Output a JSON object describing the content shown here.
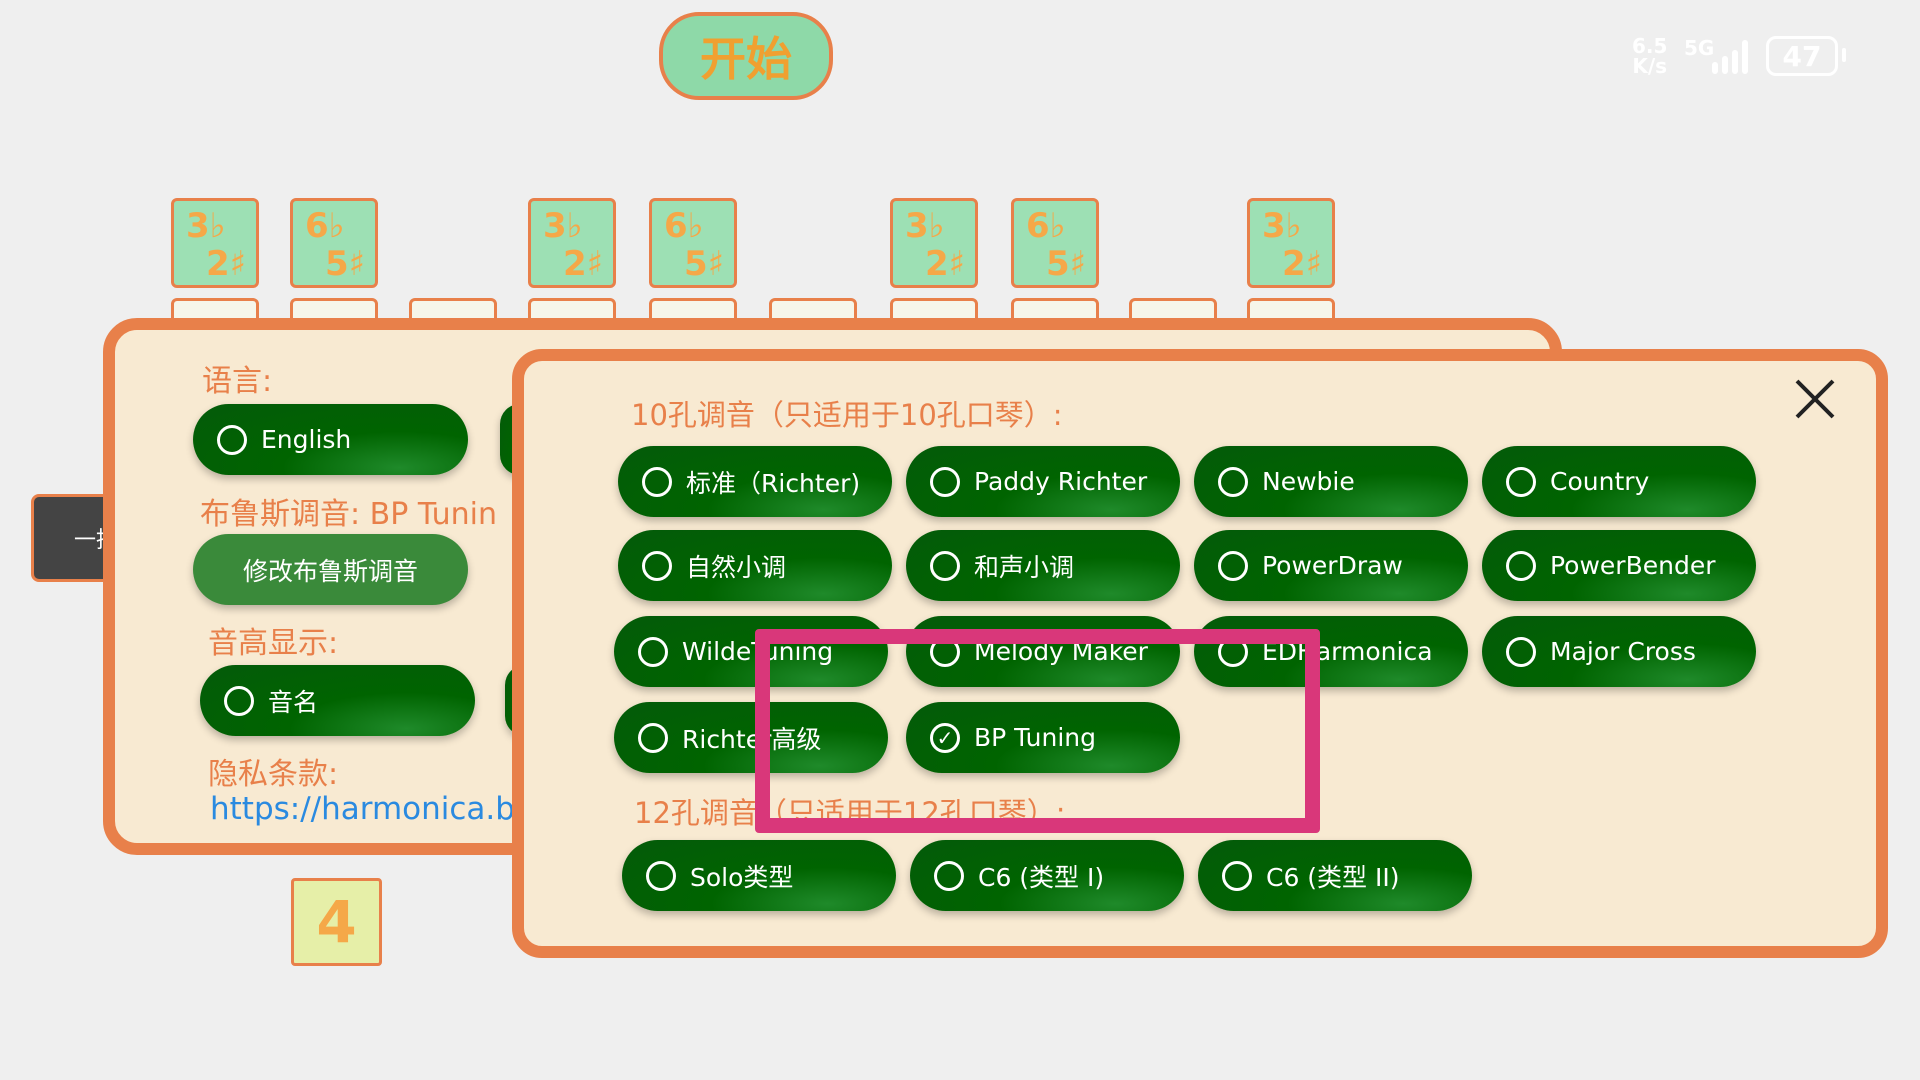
{
  "status_bar": {
    "net_speed_value": "6.5",
    "net_speed_unit": "K/s",
    "network": "5G",
    "battery": "47"
  },
  "start_button": "开始",
  "harmonica_keys": {
    "top": [
      [
        "3♭",
        "2♯"
      ],
      [
        "6♭",
        "5♯"
      ],
      [
        "3♭",
        "2♯"
      ],
      [
        "6♭",
        "5♯"
      ],
      [
        "3♭",
        "2♯"
      ],
      [
        "6♭",
        "5♯"
      ],
      [
        "3♭",
        "2♯"
      ]
    ],
    "bottom_key": "4"
  },
  "side_tab": "一指",
  "settings": {
    "language_label": "语言:",
    "language_option": "English",
    "blues_label": "布鲁斯调音: BP Tunin",
    "modify_blues_button": "修改布鲁斯调音",
    "pitch_label": "音高显示:",
    "pitch_option": "音名",
    "privacy_label": "隐私条款:",
    "privacy_link": "https://harmonica.ba"
  },
  "tuning_dialog": {
    "heading_10": "10孔调音（只适用于10孔口琴）:",
    "options_10": [
      {
        "label": "标准（Richter)",
        "selected": false
      },
      {
        "label": "Paddy Richter",
        "selected": false
      },
      {
        "label": "Newbie",
        "selected": false
      },
      {
        "label": "Country",
        "selected": false
      },
      {
        "label": "自然小调",
        "selected": false
      },
      {
        "label": "和声小调",
        "selected": false
      },
      {
        "label": "PowerDraw",
        "selected": false
      },
      {
        "label": "PowerBender",
        "selected": false
      },
      {
        "label": "WildeTuning",
        "selected": false
      },
      {
        "label": "Melody Maker",
        "selected": false
      },
      {
        "label": "EDHarmonica",
        "selected": false
      },
      {
        "label": "Major Cross",
        "selected": false
      },
      {
        "label": "Richter高级",
        "selected": false
      },
      {
        "label": "BP Tuning",
        "selected": true
      }
    ],
    "heading_12": "12孔调音（只适用于12孔口琴）:",
    "options_12": [
      {
        "label": "Solo类型",
        "selected": false
      },
      {
        "label": "C6 (类型 I)",
        "selected": false
      },
      {
        "label": "C6 (类型 II)",
        "selected": false
      }
    ]
  },
  "colors": {
    "accent_orange": "#e8804a",
    "button_green": "#006400",
    "panel_bg": "#f8ead2",
    "highlight_pink": "#d9377a",
    "link_blue": "#2a8ae0"
  }
}
